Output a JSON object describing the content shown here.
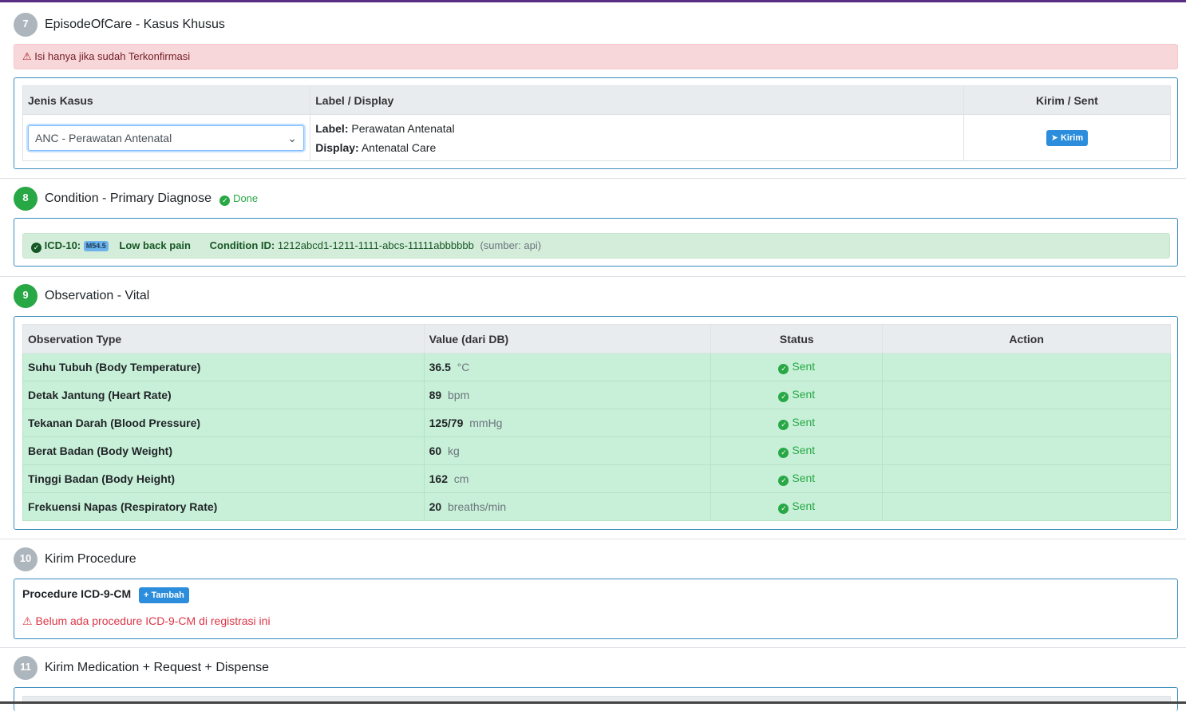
{
  "sections": {
    "s7": {
      "num": "7",
      "title": "EpisodeOfCare - Kasus Khusus",
      "alert": "Isi hanya jika sudah Terkonfirmasi",
      "headers": {
        "jenis": "Jenis Kasus",
        "label": "Label / Display",
        "kirim": "Kirim / Sent"
      },
      "select_value": "ANC - Perawatan Antenatal",
      "label_key": "Label:",
      "label_value": "Perawatan Antenatal",
      "display_key": "Display:",
      "display_value": "Antenatal Care",
      "send_button": "Kirim"
    },
    "s8": {
      "num": "8",
      "title": "Condition - Primary Diagnose",
      "status": "Done",
      "icd_label": "ICD-10:",
      "icd_code": "M54.5",
      "diagnosis": "Low back pain",
      "condition_label": "Condition ID:",
      "condition_id": "1212abcd1-1211-1111-abcs-11111abbbbbb",
      "source": "(sumber: api)"
    },
    "s9": {
      "num": "9",
      "title": "Observation - Vital",
      "headers": {
        "type": "Observation Type",
        "value": "Value (dari DB)",
        "status": "Status",
        "action": "Action"
      },
      "rows": [
        {
          "type": "Suhu Tubuh (Body Temperature)",
          "value": "36.5",
          "unit": "°C",
          "status": "Sent"
        },
        {
          "type": "Detak Jantung (Heart Rate)",
          "value": "89",
          "unit": "bpm",
          "status": "Sent"
        },
        {
          "type": "Tekanan Darah (Blood Pressure)",
          "value": "125/79",
          "unit": "mmHg",
          "status": "Sent"
        },
        {
          "type": "Berat Badan (Body Weight)",
          "value": "60",
          "unit": "kg",
          "status": "Sent"
        },
        {
          "type": "Tinggi Badan (Body Height)",
          "value": "162",
          "unit": "cm",
          "status": "Sent"
        },
        {
          "type": "Frekuensi Napas (Respiratory Rate)",
          "value": "20",
          "unit": "breaths/min",
          "status": "Sent"
        }
      ]
    },
    "s10": {
      "num": "10",
      "title": "Kirim Procedure",
      "procedure_label": "Procedure ICD-9-CM",
      "add_button": "Tambah",
      "empty_warning": "Belum ada procedure ICD-9-CM di registrasi ini"
    },
    "s11": {
      "num": "11",
      "title": "Kirim Medication + Request + Dispense"
    }
  },
  "colors": {
    "accent_blue": "#3c8dbc",
    "success_green": "#28a745",
    "danger_red": "#dc3545",
    "row_green": "#c8f0d8"
  }
}
